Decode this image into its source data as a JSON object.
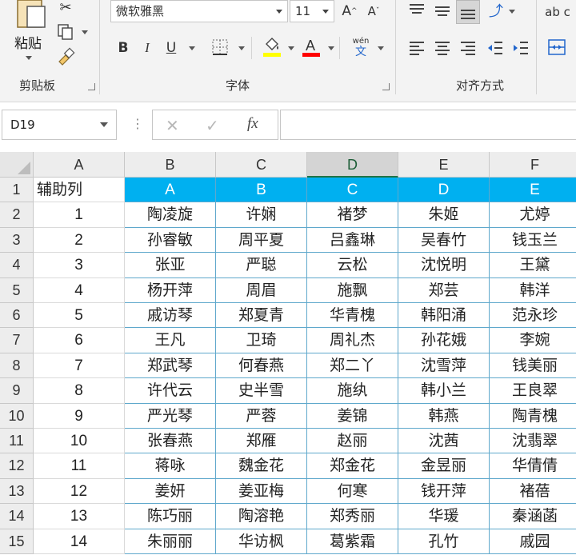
{
  "ribbon": {
    "clipboard": {
      "group_label": "剪贴板",
      "paste_label": "粘贴"
    },
    "font": {
      "group_label": "字体",
      "font_name": "微软雅黑",
      "font_size": "11",
      "bold": "B",
      "italic": "I",
      "underline": "U",
      "wen_label": "wén",
      "wen_char": "文"
    },
    "alignment": {
      "group_label": "对齐方式"
    },
    "wrap_label": "ab c",
    "colors": {
      "highlight": "#ffff00",
      "font_color": "#ff0000",
      "accent": "#217346",
      "header_fill": "#00b0f0"
    }
  },
  "formula_bar": {
    "name_box": "D19",
    "fx_label": "fx",
    "cancel_icon": "✕",
    "enter_icon": "✓",
    "formula_value": ""
  },
  "sheet": {
    "selected_column": "D",
    "columns": [
      "A",
      "B",
      "C",
      "D",
      "E",
      "F"
    ],
    "rows": [
      {
        "num": "1",
        "cells": [
          "辅助列",
          "A",
          "B",
          "C",
          "D",
          "E"
        ]
      },
      {
        "num": "2",
        "cells": [
          "1",
          "陶凌旋",
          "许娴",
          "褚梦",
          "朱姬",
          "尤婷"
        ]
      },
      {
        "num": "3",
        "cells": [
          "2",
          "孙睿敏",
          "周平夏",
          "吕鑫琳",
          "吴春竹",
          "钱玉兰"
        ]
      },
      {
        "num": "4",
        "cells": [
          "3",
          "张亚",
          "严聪",
          "云松",
          "沈悦明",
          "王黛"
        ]
      },
      {
        "num": "5",
        "cells": [
          "4",
          "杨开萍",
          "周眉",
          "施飘",
          "郑芸",
          "韩洋"
        ]
      },
      {
        "num": "6",
        "cells": [
          "5",
          "戚访琴",
          "郑夏青",
          "华青槐",
          "韩阳涌",
          "范永珍"
        ]
      },
      {
        "num": "7",
        "cells": [
          "6",
          "王凡",
          "卫琦",
          "周礼杰",
          "孙花娥",
          "李婉"
        ]
      },
      {
        "num": "8",
        "cells": [
          "7",
          "郑武琴",
          "何春燕",
          "郑二丫",
          "沈雪萍",
          "钱美丽"
        ]
      },
      {
        "num": "9",
        "cells": [
          "8",
          "许代云",
          "史半雪",
          "施纨",
          "韩小兰",
          "王良翠"
        ]
      },
      {
        "num": "10",
        "cells": [
          "9",
          "严光琴",
          "严蓉",
          "姜锦",
          "韩燕",
          "陶青槐"
        ]
      },
      {
        "num": "11",
        "cells": [
          "10",
          "张春燕",
          "郑雁",
          "赵丽",
          "沈茜",
          "沈翡翠"
        ]
      },
      {
        "num": "12",
        "cells": [
          "11",
          "蒋咏",
          "魏金花",
          "郑金花",
          "金昱丽",
          "华倩倩"
        ]
      },
      {
        "num": "13",
        "cells": [
          "12",
          "姜妍",
          "姜亚梅",
          "何寒",
          "钱开萍",
          "褚蓓"
        ]
      },
      {
        "num": "14",
        "cells": [
          "13",
          "陈巧丽",
          "陶溶艳",
          "郑秀丽",
          "华瑗",
          "秦涵菡"
        ]
      },
      {
        "num": "15",
        "cells": [
          "14",
          "朱丽丽",
          "华访枫",
          "葛紫霜",
          "孔竹",
          "戚园"
        ]
      }
    ]
  }
}
